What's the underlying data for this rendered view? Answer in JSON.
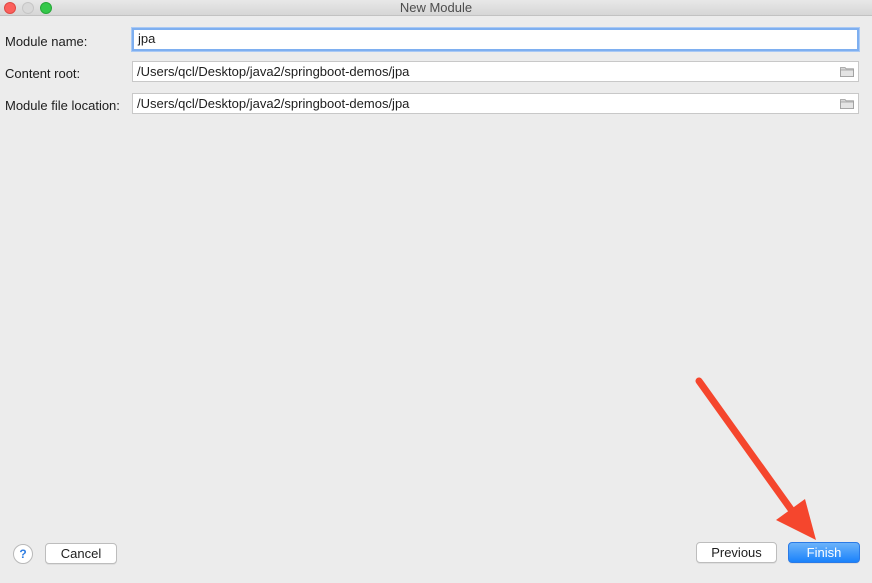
{
  "window": {
    "title": "New Module"
  },
  "form": {
    "module_name": {
      "label": "Module name:",
      "value": "jpa"
    },
    "content_root": {
      "label": "Content root:",
      "value": "/Users/qcl/Desktop/java2/springboot-demos/jpa"
    },
    "module_file_location": {
      "label": "Module file location:",
      "value": "/Users/qcl/Desktop/java2/springboot-demos/jpa"
    }
  },
  "footer": {
    "help_label": "?",
    "cancel_label": "Cancel",
    "previous_label": "Previous",
    "finish_label": "Finish"
  },
  "colors": {
    "accent": "#1a82fb",
    "annotation_arrow": "#f5462d",
    "close": "#fc605c",
    "maximize": "#34c84a"
  },
  "icons": [
    "folder-icon",
    "help-icon",
    "annotation-arrow"
  ]
}
